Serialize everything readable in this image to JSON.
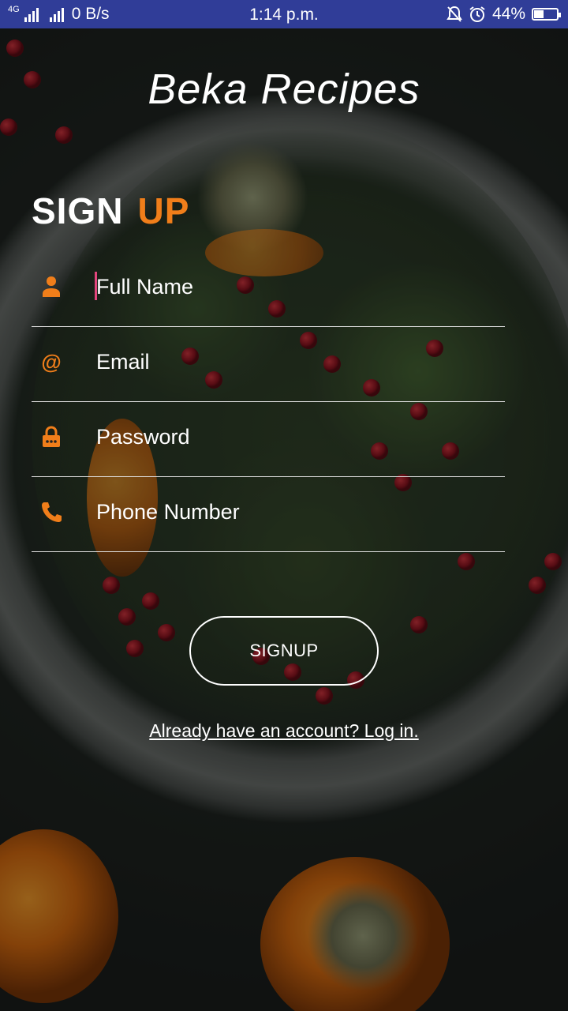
{
  "status_bar": {
    "network": "4G",
    "data_rate": "0 B/s",
    "time": "1:14 p.m.",
    "battery": "44%",
    "battery_level": 0.44,
    "icons": [
      "signal-icon",
      "mute-bell-icon",
      "alarm-icon",
      "battery-icon"
    ]
  },
  "app": {
    "title": "Beka Recipes"
  },
  "heading": {
    "word1": "SIGN",
    "word2": "UP"
  },
  "form": {
    "full_name": {
      "placeholder": "Full Name",
      "icon": "person-icon"
    },
    "email": {
      "placeholder": "Email",
      "icon": "at-icon"
    },
    "password": {
      "placeholder": "Password",
      "icon": "lock-icon"
    },
    "phone": {
      "placeholder": "Phone Number",
      "icon": "phone-icon"
    }
  },
  "signup_button": {
    "label": "SIGNUP"
  },
  "login_link": {
    "label": "Already have an account? Log in."
  },
  "colors": {
    "accent": "#f07e1a",
    "status_bar": "#303d98",
    "cursor": "#e2457c"
  }
}
